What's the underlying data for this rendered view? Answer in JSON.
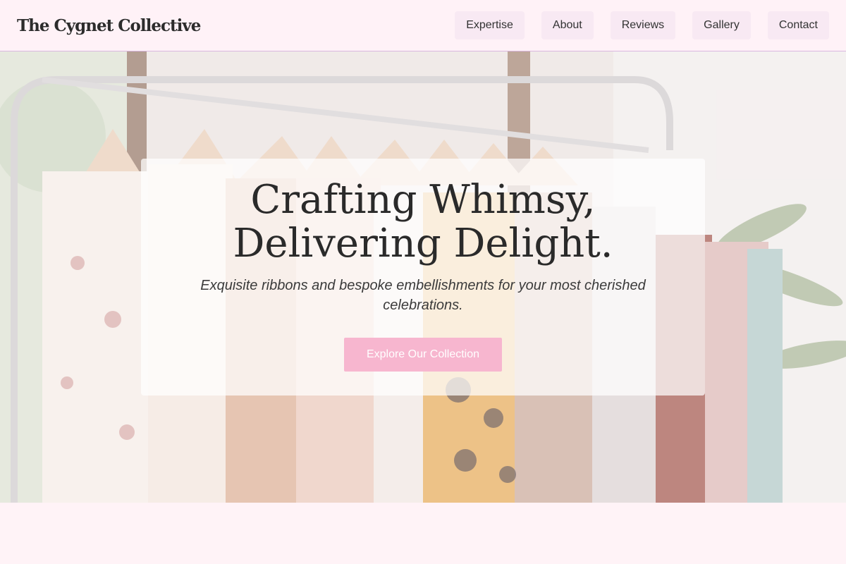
{
  "brand": {
    "name": "The Cygnet Collective"
  },
  "nav": {
    "items": [
      {
        "label": "Expertise"
      },
      {
        "label": "About"
      },
      {
        "label": "Reviews"
      },
      {
        "label": "Gallery"
      },
      {
        "label": "Contact"
      }
    ]
  },
  "hero": {
    "title_line1": "Crafting Whimsy,",
    "title_line2": "Delivering Delight.",
    "subtitle": "Exquisite ribbons and bespoke embellishments for your most cherished celebrations.",
    "cta_label": "Explore Our Collection",
    "background_image": "clothing-rack-photo"
  },
  "colors": {
    "page_bg": "#fff3f7",
    "nav_pill": "#f8e9f3",
    "cta_bg": "#f7b6cf",
    "nav_border": "#d9b7e0"
  }
}
